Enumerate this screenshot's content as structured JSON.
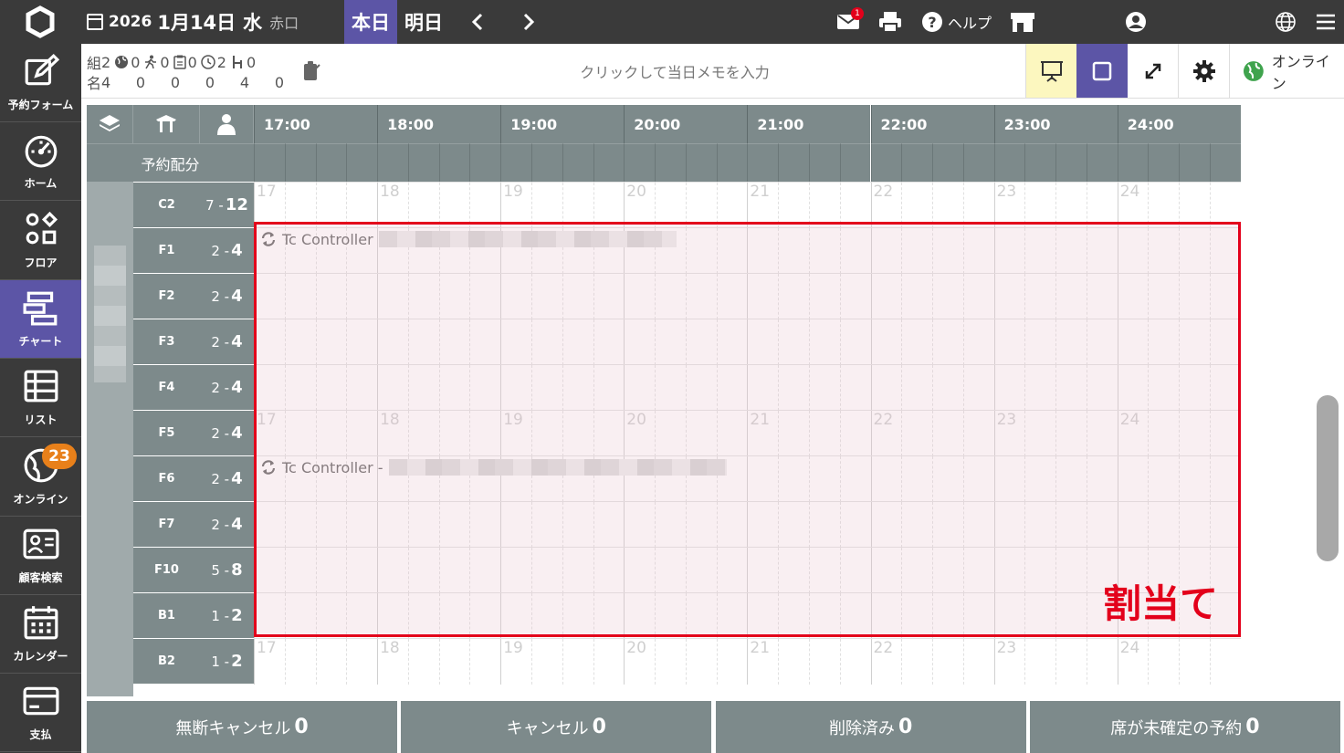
{
  "topbar": {
    "year": "2026",
    "date": "1月14日",
    "weekday": "水",
    "rokuyo": "赤口",
    "today_button": "本日",
    "tomorrow_button": "明日",
    "mail_badge": "1",
    "help_label": "ヘルプ"
  },
  "sidebar": {
    "items": [
      {
        "label": "予約フォーム",
        "icon": "edit-icon"
      },
      {
        "label": "ホーム",
        "icon": "dashboard-icon"
      },
      {
        "label": "フロア",
        "icon": "floor-icon"
      },
      {
        "label": "チャート",
        "icon": "chart-icon"
      },
      {
        "label": "リスト",
        "icon": "list-icon"
      },
      {
        "label": "オンライン",
        "icon": "globe-icon",
        "badge": "23"
      },
      {
        "label": "顧客検索",
        "icon": "customer-card-icon"
      },
      {
        "label": "カレンダー",
        "icon": "calendar-icon"
      },
      {
        "label": "支払",
        "icon": "payment-card-icon"
      }
    ]
  },
  "stats": {
    "groups_label": "組",
    "people_label": "名",
    "columns": [
      {
        "icon": "none",
        "groups": "2",
        "people": "4"
      },
      {
        "icon": "globe-icon",
        "groups": "0",
        "people": "0"
      },
      {
        "icon": "walk-in-icon",
        "groups": "0",
        "people": "0"
      },
      {
        "icon": "clipboard-icon",
        "groups": "0",
        "people": "0"
      },
      {
        "icon": "clock-icon",
        "groups": "2",
        "people": "4"
      },
      {
        "icon": "seat-icon",
        "groups": "0",
        "people": "0"
      }
    ]
  },
  "memo_placeholder": "クリックして当日メモを入力",
  "online_label": "オンライン",
  "chart": {
    "allocation_label": "予約配分",
    "hours": [
      "17:00",
      "18:00",
      "19:00",
      "20:00",
      "21:00",
      "22:00",
      "23:00",
      "24:00"
    ],
    "ghost_hours": [
      "17",
      "18",
      "19",
      "20",
      "21",
      "22",
      "23",
      "24"
    ],
    "rows": [
      {
        "name": "C2",
        "min": "7",
        "max": "12"
      },
      {
        "name": "F1",
        "min": "2",
        "max": "4"
      },
      {
        "name": "F2",
        "min": "2",
        "max": "4"
      },
      {
        "name": "F3",
        "min": "2",
        "max": "4"
      },
      {
        "name": "F4",
        "min": "2",
        "max": "4"
      },
      {
        "name": "F5",
        "min": "2",
        "max": "4"
      },
      {
        "name": "F6",
        "min": "2",
        "max": "4"
      },
      {
        "name": "F7",
        "min": "2",
        "max": "4"
      },
      {
        "name": "F10",
        "min": "5",
        "max": "8"
      },
      {
        "name": "B1",
        "min": "1",
        "max": "2"
      },
      {
        "name": "B2",
        "min": "1",
        "max": "2"
      }
    ],
    "bookings": [
      {
        "text": "Tc Controller",
        "row": 1
      },
      {
        "text": "Tc Controller -",
        "row": 6
      }
    ],
    "assign_label": "割当て"
  },
  "footer": [
    {
      "label": "無断キャンセル",
      "count": "0"
    },
    {
      "label": "キャンセル",
      "count": "0"
    },
    {
      "label": "削除済み",
      "count": "0"
    },
    {
      "label": "席が未確定の予約",
      "count": "0"
    }
  ],
  "colors": {
    "accent": "#5c55a6",
    "dark": "#3a3a3a",
    "header": "#7d8a8b",
    "assign": "#e3001b"
  }
}
